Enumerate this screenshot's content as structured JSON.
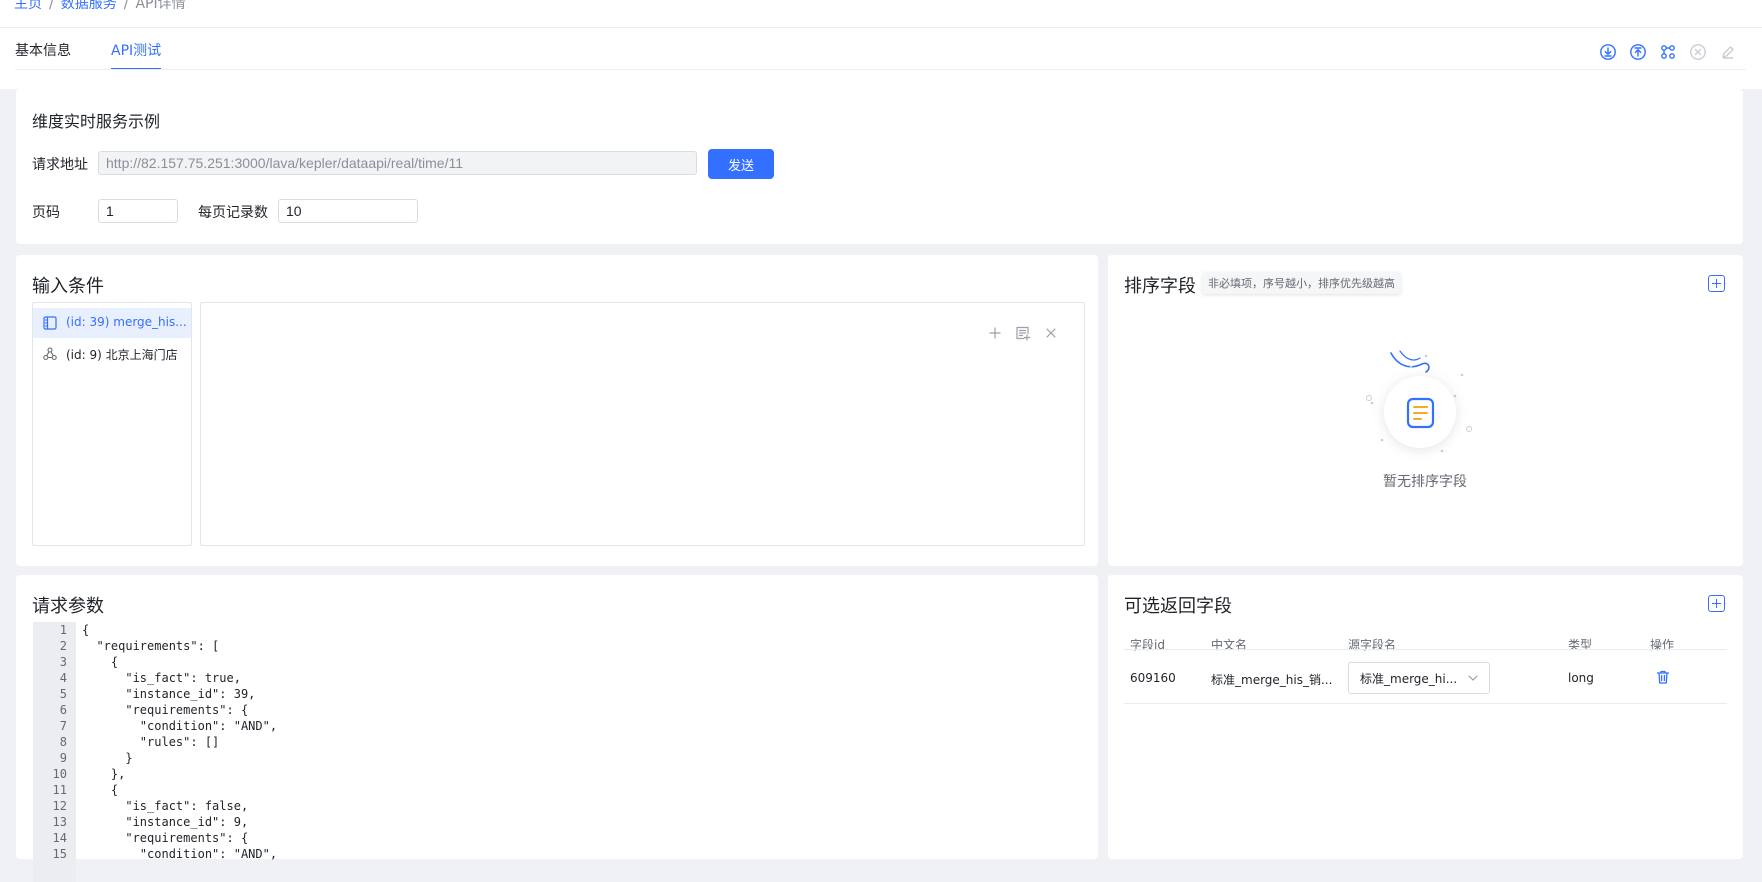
{
  "breadcrumb": {
    "home": "主页",
    "data_service": "数据服务",
    "current": "API详情",
    "separator": "/"
  },
  "tabs": [
    {
      "label": "基本信息"
    },
    {
      "label": "API测试"
    }
  ],
  "toolbar": {
    "icons": [
      "download-circle-icon",
      "upload-circle-icon",
      "share-nodes-icon",
      "close-circle-icon",
      "edit-pen-icon"
    ]
  },
  "example": {
    "title": "维度实时服务示例",
    "request_url_label": "请求地址",
    "request_url": "http://82.157.75.251:3000/lava/kepler/dataapi/real/time/11",
    "send_label": "发送",
    "page_label": "页码",
    "page_value": "1",
    "page_size_label": "每页记录数",
    "page_size_value": "10"
  },
  "input_conditions": {
    "title": "输入条件",
    "items": [
      {
        "label": "(id: 39) merge_his...",
        "icon": "table-icon",
        "selected": true
      },
      {
        "label": "(id: 9) 北京上海门店",
        "icon": "graph-nodes-icon",
        "selected": false
      }
    ],
    "editor_icons": [
      "plus-icon",
      "add-list-icon",
      "close-icon"
    ]
  },
  "sort_fields": {
    "title": "排序字段",
    "hint": "非必填项，序号越小，排序优先级越高",
    "empty_text": "暂无排序字段"
  },
  "request_params": {
    "title": "请求参数",
    "lines": [
      "{",
      "  \"requirements\": [",
      "    {",
      "      \"is_fact\": true,",
      "      \"instance_id\": 39,",
      "      \"requirements\": {",
      "        \"condition\": \"AND\",",
      "        \"rules\": []",
      "      }",
      "    },",
      "    {",
      "      \"is_fact\": false,",
      "      \"instance_id\": 9,",
      "      \"requirements\": {",
      "        \"condition\": \"AND\","
    ]
  },
  "return_fields": {
    "title": "可选返回字段",
    "columns": [
      "字段id",
      "中文名",
      "源字段名",
      "类型",
      "操作"
    ],
    "rows": [
      {
        "id": "609160",
        "cn_name": "标准_merge_his_销...",
        "source": "标准_merge_hi...",
        "type": "long"
      }
    ]
  },
  "colors": {
    "accent": "#3370ff",
    "background": "#f0f1f4",
    "card": "#ffffff"
  }
}
